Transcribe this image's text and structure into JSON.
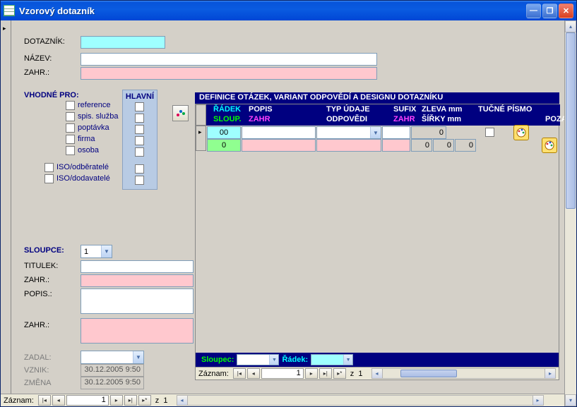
{
  "window": {
    "title": "Vzorový dotazník"
  },
  "labels": {
    "dotaznik": "DOTAZNÍK:",
    "nazev": "NÁZEV:",
    "zahr": "ZAHR.:",
    "vhodne_pro": "VHODNÉ PRO:",
    "hlavni": "HLAVNÍ",
    "sloupce": "SLOUPCE:",
    "titulek": "TITULEK:",
    "zahr2": "ZAHR.:",
    "popis": "POPIS.:",
    "zahr3": "ZAHR.:",
    "zadal": "ZADAL:",
    "vznik": "VZNIK:",
    "zmena": "ZMĚNA"
  },
  "checkboxes": {
    "reference": "reference",
    "spis_sluzba": "spis. služba",
    "poptavka": "poptávka",
    "firma": "firma",
    "osoba": "osoba",
    "iso_odberatele": "ISO/odběratelé",
    "iso_dodavatele": "ISO/dodavatelé"
  },
  "sloupce_value": "1",
  "vznik_value": "30.12.2005 9:50",
  "zmena_value": "30.12.2005 9:50",
  "subform": {
    "title": "DEFINICE OTÁZEK, VARIANT ODPOVĚDÍ A DESIGNU DOTAZNÍKU",
    "headers": {
      "radek": "ŘÁDEK",
      "sloup": "SLOUP.",
      "popis": "POPIS",
      "zahr": "ZAHR",
      "typ_udaje": "TYP ÚDAJE",
      "odpovedi": "ODPOVĚDI",
      "sufix": "SUFIX",
      "zahr2": "ZAHR",
      "zleva": "ZLEVA mm",
      "sirky": "ŠÍŘKY mm",
      "tucne": "TUČNÉ PÍSMO",
      "poza": "POZA"
    },
    "row1": {
      "radek": "00",
      "zleva": "0"
    },
    "row2": {
      "sloup": "0",
      "s1": "0",
      "s2": "0",
      "s3": "0"
    },
    "footer": {
      "sloupec": "Sloupec:",
      "radek": "Řádek:"
    }
  },
  "recnav": {
    "label": "Záznam:",
    "value": "1",
    "of_sep": "z",
    "of_total": "1"
  }
}
